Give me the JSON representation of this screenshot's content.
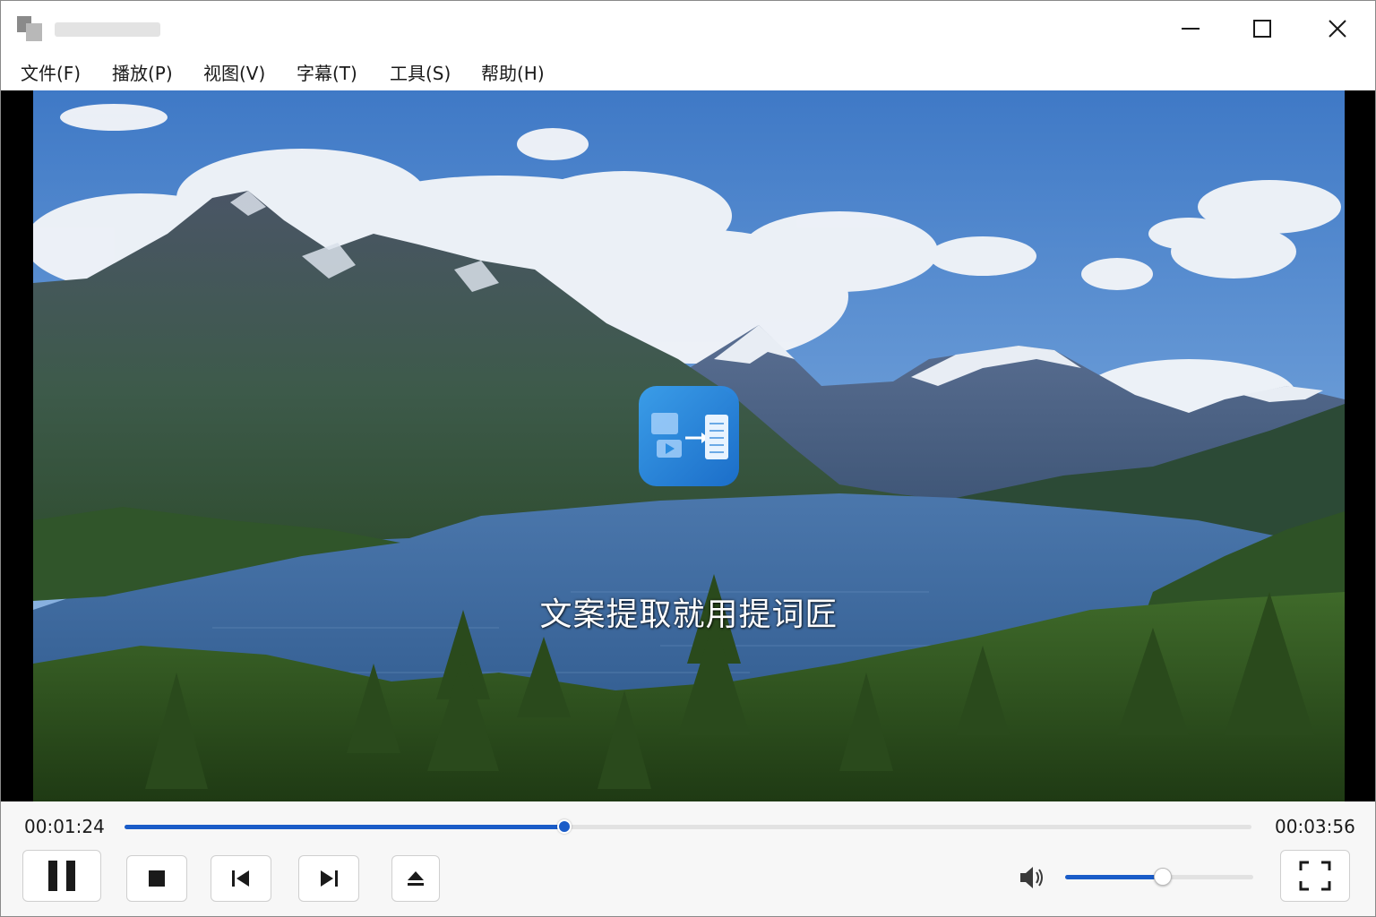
{
  "window": {
    "minimize_icon": "minimize-icon",
    "maximize_icon": "maximize-icon",
    "close_icon": "close-icon"
  },
  "menu": {
    "items": [
      {
        "label": "文件(F)"
      },
      {
        "label": "播放(P)"
      },
      {
        "label": "视图(V)"
      },
      {
        "label": "字幕(T)"
      },
      {
        "label": "工具(S)"
      },
      {
        "label": "帮助(H)"
      }
    ]
  },
  "video": {
    "overlay_text": "文案提取就用提词匠",
    "overlay_icon": "video-to-text-logo-icon"
  },
  "playback": {
    "current_time": "00:01:24",
    "total_time": "00:03:56",
    "progress": 0.39,
    "volume": 0.52
  },
  "controls": {
    "pause_icon": "pause-icon",
    "stop_icon": "stop-icon",
    "previous_icon": "skip-previous-icon",
    "next_icon": "skip-next-icon",
    "eject_icon": "eject-icon",
    "volume_icon": "speaker-icon",
    "fullscreen_icon": "fullscreen-icon"
  },
  "colors": {
    "accent": "#1a5cc8",
    "logo": "#2a8ce0"
  }
}
